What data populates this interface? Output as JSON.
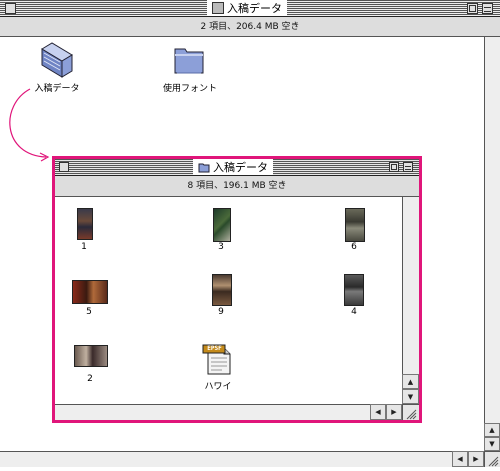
{
  "outer_window": {
    "title": "入稿データ",
    "info": "2 項目、206.4 MB 空き",
    "items": [
      {
        "label": "入稿データ",
        "icon": "folder-icon-shared"
      },
      {
        "label": "使用フォント",
        "icon": "folder-icon"
      }
    ]
  },
  "inner_window": {
    "title": "入稿データ",
    "info": "8 項目、196.1 MB 空き",
    "items": [
      {
        "label": "1"
      },
      {
        "label": "3"
      },
      {
        "label": "6"
      },
      {
        "label": "5"
      },
      {
        "label": "9"
      },
      {
        "label": "4"
      },
      {
        "label": "2"
      },
      {
        "label": "ハワイ",
        "badge": "EPSF"
      }
    ]
  },
  "colors": {
    "highlight": "#e0157a",
    "folder": "#8c9fd8",
    "chrome": "#dddddd"
  }
}
